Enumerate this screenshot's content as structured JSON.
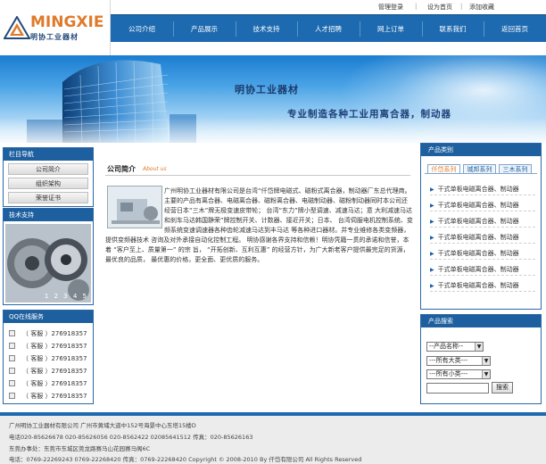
{
  "logo": {
    "en": "MINGXIE",
    "cn": "明协工业器材"
  },
  "toplinks": [
    "管理登录",
    "设为首页",
    "添加收藏"
  ],
  "nav": [
    "公司介绍",
    "产品展示",
    "技术支持",
    "人才招聘",
    "网上订单",
    "联系我们",
    "返回首页"
  ],
  "banner": {
    "title": "明协工业器材",
    "slogan": "专业制造各种工业用离合器，制动器"
  },
  "left": {
    "nav_title": "栏目导航",
    "nav_items": [
      "公司简介",
      "组织架构",
      "荣誉证书"
    ],
    "tech_title": "技术支持",
    "tech_pages": "1 2 3 4 5",
    "qq_title": "QQ在线服务",
    "qq_items": [
      "（ 客服 ）276918357",
      "（ 客服 ）276918357",
      "（ 客服 ）276918357",
      "（ 客服 ）276918357",
      "（ 客服 ）276918357",
      "（ 客服 ）276918357"
    ]
  },
  "about": {
    "title": "公司简介",
    "sub": "About us",
    "text": "广州明协工业器材有限公司是台湾“仟岱牌电磁式、磁粉式离合器，制动器厂东总代理商。主要的产品有离合器、电磁离合器、磁粉离合器、电磁制动器、磁粉制动器同时本公司还经营日本“三木”牌无极变速皮带轮； 台湾“东力”牌小型调速、减速马达；意 大利减速马达和刹车马达韩国静荣”牌控制开关、计数器、接近开关；日本、 台湾伺服电机控制系统、变频系统变速调速器各种齿轮减速马达到丰马达 等各种进口器材。并专业维修各类变频器，提供变频器技术 咨询及对外承接自动化控制工程。 明协感谢各界支持和信赖！明协凭籍一贯的承诺和信誉，本着 “客户至上、质量第一” 的宗 旨， “开拓创新、互利互惠” 的经营方针，为广大新老客户提供最完足的货源，最优良的品质， 最优惠的价格，更全面、更优质的服务。"
  },
  "right": {
    "prod_title": "产品类别",
    "tabs": [
      "仟岱系列",
      "城邦系列",
      "三木系列"
    ],
    "products": [
      "干式单板电磁离合器、制动器",
      "干式单板电磁离合器、制动器",
      "干式单板电磁离合器、制动器",
      "干式单板电磁离合器、制动器",
      "干式单板电磁离合器、制动器",
      "干式单板电磁离合器、制动器",
      "干式单板电磁离合器、制动器"
    ],
    "search_title": "产品搜索",
    "selects": [
      "--产品名称--",
      "---所有大类---",
      "---所有小类---"
    ],
    "search_btn": "搜索"
  },
  "footer": {
    "lines": [
      "广州明协工业器材有限公司 广州市黄埔大道中152号海景中心东塔15楼D",
      "电话020-85626678 020-85626056 020-8562422 02085641512 传真：020-85626163",
      "东莞办事处：东莞市东城区莞龙路赛马山花园赛马阁6C",
      "电话：0769-22269243 0769-22268420 传真：0769-22268420   Copyright © 2008-2010 By 仟岱有限公司 All Rights Reserved"
    ]
  },
  "colors": {
    "nav_blue": "#1d6ab0",
    "panel_blue": "#1d5f9f",
    "logo_orange": "#e07a2a"
  }
}
